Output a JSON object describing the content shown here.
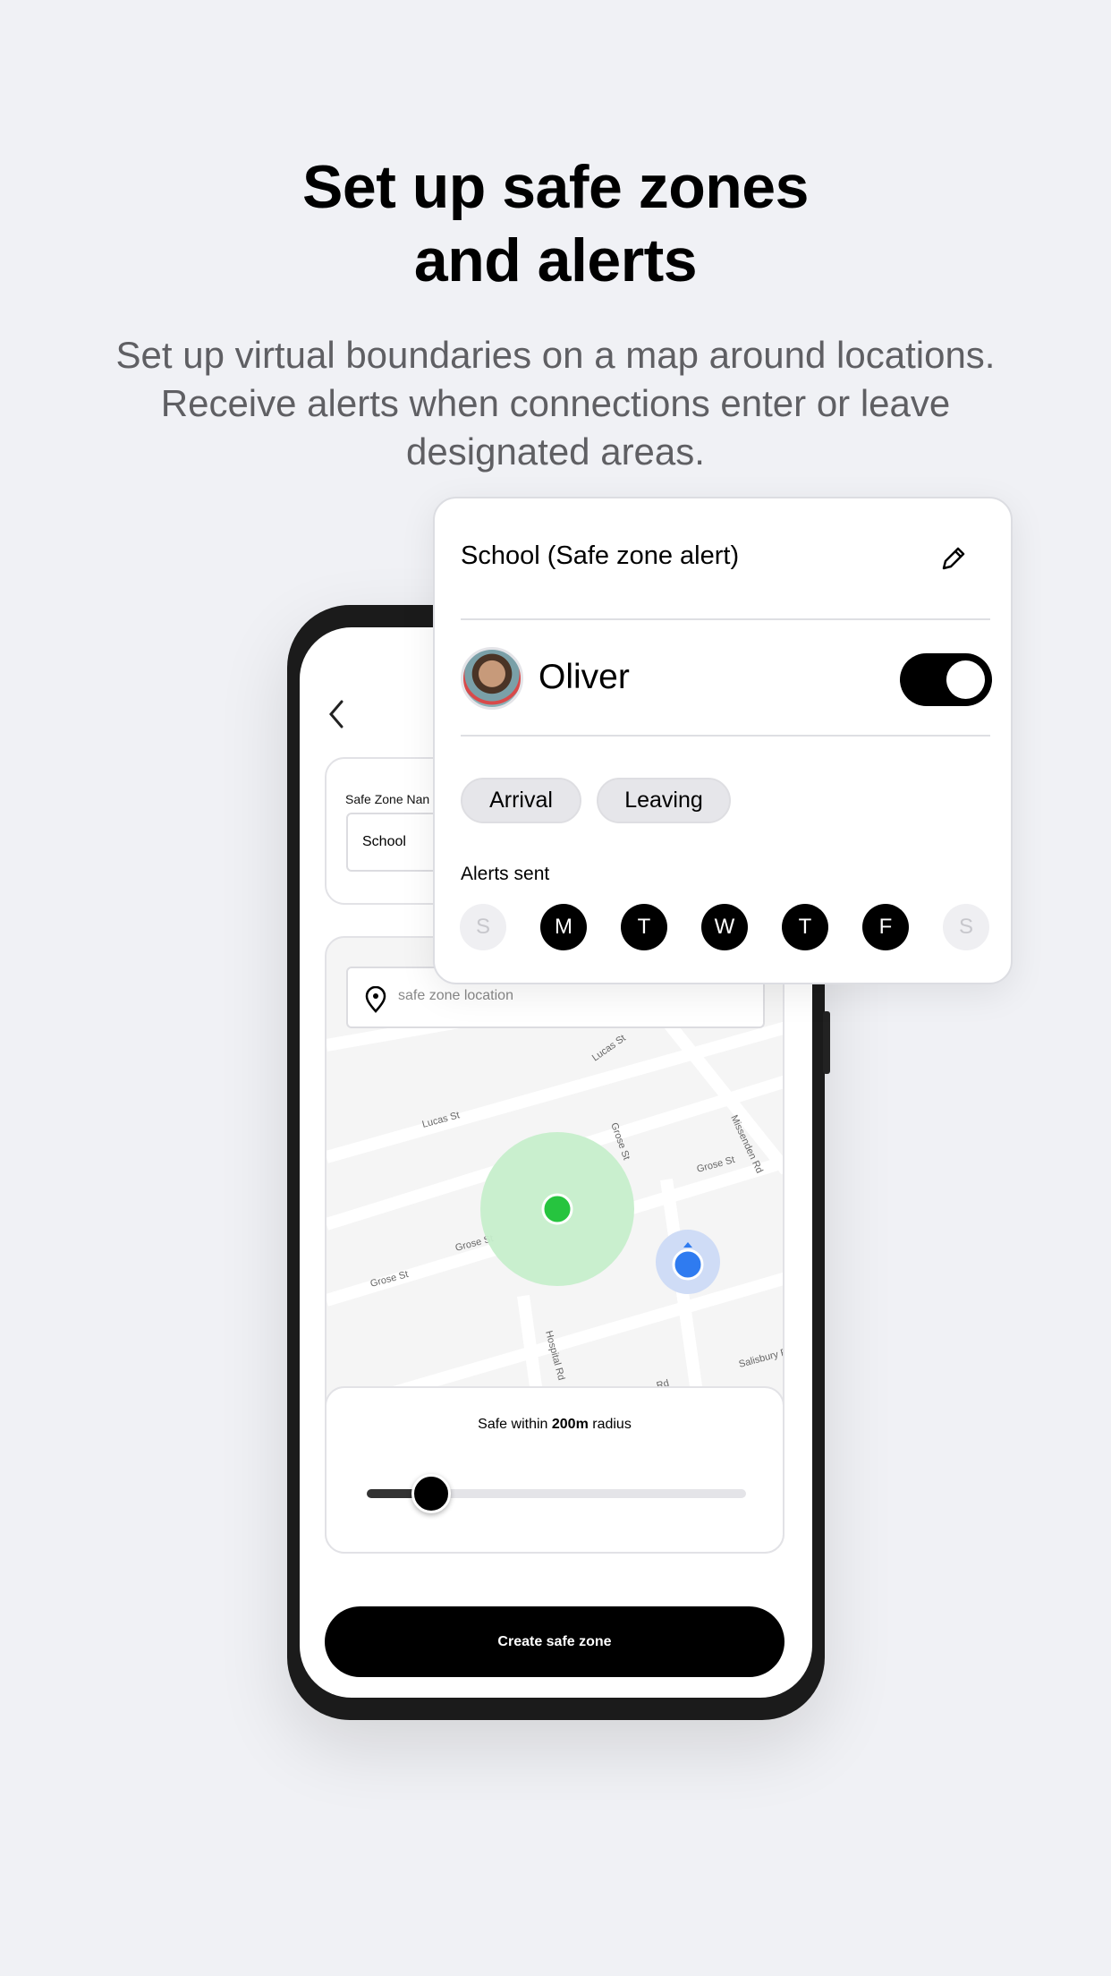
{
  "header": {
    "title_line1": "Set up safe zones",
    "title_line2": "and alerts",
    "subtitle": "Set up virtual boundaries on a map around locations. Receive alerts when connections enter or leave designated areas."
  },
  "phone": {
    "name_label": "Safe Zone Nan",
    "name_value": "School",
    "search_placeholder": "safe zone location",
    "map_labels": {
      "lucas1": "Lucas St",
      "lucas2": "Lucas St",
      "grose1": "Grose St",
      "grose2": "Grose St",
      "grose3": "Grose St",
      "grose4": "Grose St",
      "missenden": "Missenden Rd",
      "hospital": "Hospital Rd",
      "salisbury": "Salisbury Rd",
      "st": "St",
      "rd": "Rd"
    },
    "radius_prefix": "Safe within ",
    "radius_value": "200m",
    "radius_suffix": " radius",
    "radius_slider_percent": 17,
    "create_button": "Create safe zone"
  },
  "popup": {
    "title": "School (Safe zone alert)",
    "person_name": "Oliver",
    "toggle_on": true,
    "chips": [
      "Arrival",
      "Leaving"
    ],
    "alerts_label": "Alerts sent",
    "days": [
      {
        "label": "S",
        "active": false
      },
      {
        "label": "M",
        "active": true
      },
      {
        "label": "T",
        "active": true
      },
      {
        "label": "W",
        "active": true
      },
      {
        "label": "T",
        "active": true
      },
      {
        "label": "F",
        "active": true
      },
      {
        "label": "S",
        "active": false
      }
    ]
  },
  "colors": {
    "zone_green": "#26c43f",
    "zone_fill": "#c6eecb",
    "user_blue": "#2f7bf0",
    "background": "#f0f1f5"
  }
}
